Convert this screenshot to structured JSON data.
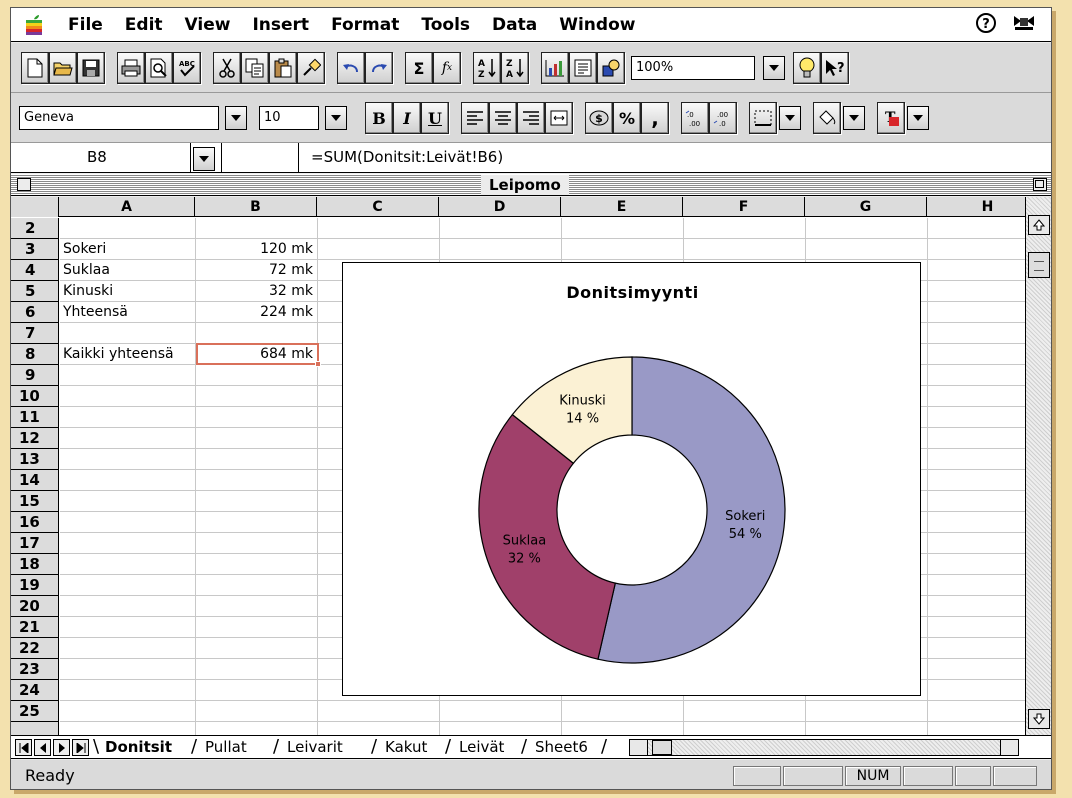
{
  "menubar": {
    "items": [
      "File",
      "Edit",
      "View",
      "Insert",
      "Format",
      "Tools",
      "Data",
      "Window"
    ]
  },
  "toolbar": {
    "zoom": "100%",
    "font": "Geneva",
    "font_size": "10",
    "bold": "B",
    "italic": "I",
    "underline": "U",
    "percent": "%",
    "comma": ","
  },
  "formula_bar": {
    "cell_ref": "B8",
    "formula": "=SUM(Donitsit:Leivät!B6)"
  },
  "document": {
    "title": "Leipomo"
  },
  "columns": [
    "A",
    "B",
    "C",
    "D",
    "E",
    "F",
    "G",
    "H"
  ],
  "rows": [
    "2",
    "3",
    "4",
    "5",
    "6",
    "7",
    "8",
    "9",
    "10",
    "11",
    "12",
    "13",
    "14",
    "15",
    "16",
    "17",
    "18",
    "19",
    "20",
    "21",
    "22",
    "23",
    "24",
    "25"
  ],
  "cells": {
    "a3": "Sokeri",
    "b3": "120 mk",
    "a4": "Suklaa",
    "b4": "72 mk",
    "a5": "Kinuski",
    "b5": "32 mk",
    "a6": "Yhteensä",
    "b6": "224 mk",
    "a8": "Kaikki yhteensä",
    "b8": "684 mk"
  },
  "chart_data": {
    "type": "pie",
    "variant": "doughnut",
    "title": "Donitsimyynti",
    "categories": [
      "Sokeri",
      "Suklaa",
      "Kinuski"
    ],
    "values": [
      120,
      72,
      32
    ],
    "percent_labels": [
      "54 %",
      "32 %",
      "14 %"
    ],
    "colors": [
      "#9999c6",
      "#a0406a",
      "#fbf1d4"
    ],
    "legend": "none"
  },
  "tabs": [
    "Donitsit",
    "Pullat",
    "Leivarit",
    "Kakut",
    "Leivät",
    "Sheet6"
  ],
  "active_tab": "Donitsit",
  "status": {
    "text": "Ready",
    "num": "NUM"
  }
}
